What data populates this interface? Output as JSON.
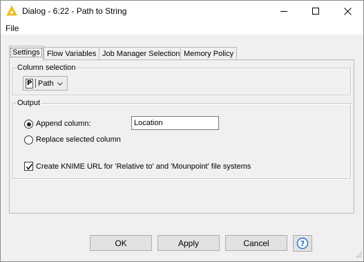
{
  "window": {
    "title": "Dialog - 6:22 - Path to String",
    "icon": "knime-warning-triangle-icon",
    "controls": [
      "minimize-icon",
      "maximize-icon",
      "close-icon"
    ]
  },
  "menu": {
    "items": [
      {
        "label": "File"
      }
    ]
  },
  "tabs": [
    {
      "label": "Settings",
      "active": true
    },
    {
      "label": "Flow Variables",
      "active": false
    },
    {
      "label": "Job Manager Selection",
      "active": false
    },
    {
      "label": "Memory Policy",
      "active": false
    }
  ],
  "settings": {
    "column_selection": {
      "title": "Column selection",
      "selected_column": "Path",
      "column_type_badge": "P"
    },
    "output": {
      "title": "Output",
      "append_column_label": "Append column:",
      "append_column_value": "Location",
      "replace_column_label": "Replace selected column",
      "mode": "append",
      "create_url_label": "Create KNIME URL for 'Relative to' and 'Mounpoint' file systems",
      "create_url_checked": true
    }
  },
  "footer": {
    "ok_label": "OK",
    "apply_label": "Apply",
    "cancel_label": "Cancel",
    "help_icon": "help-question-icon"
  },
  "colors": {
    "accent_blue": "#1e6fd9",
    "knime_yellow": "#f5c211",
    "background": "#f0f0f0"
  }
}
